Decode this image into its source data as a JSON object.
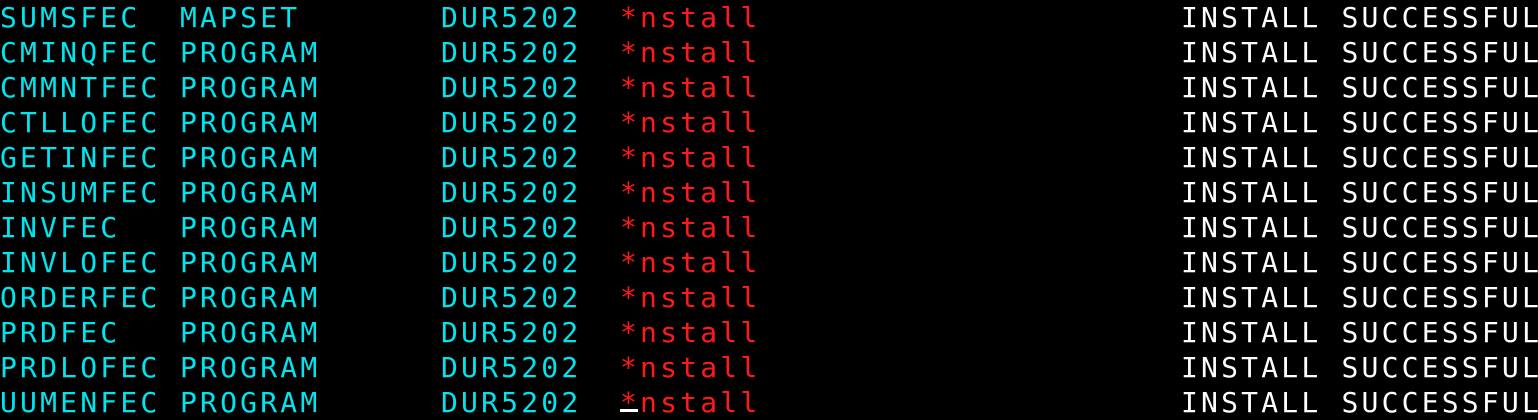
{
  "colors": {
    "background": "#000000",
    "field_text": "#00e5ee",
    "command_text": "#ff1a1a",
    "message_text": "#ffffff",
    "cursor": "#ffffff"
  },
  "rows": [
    {
      "name": "SUMSFEC",
      "type": "MAPSET",
      "group": "DUR5202",
      "command": "*nstall",
      "message": "INSTALL SUCCESSFUL"
    },
    {
      "name": "CMINQFEC",
      "type": "PROGRAM",
      "group": "DUR5202",
      "command": "*nstall",
      "message": "INSTALL SUCCESSFUL"
    },
    {
      "name": "CMMNTFEC",
      "type": "PROGRAM",
      "group": "DUR5202",
      "command": "*nstall",
      "message": "INSTALL SUCCESSFUL"
    },
    {
      "name": "CTLLOFEC",
      "type": "PROGRAM",
      "group": "DUR5202",
      "command": "*nstall",
      "message": "INSTALL SUCCESSFUL"
    },
    {
      "name": "GETINFEC",
      "type": "PROGRAM",
      "group": "DUR5202",
      "command": "*nstall",
      "message": "INSTALL SUCCESSFUL"
    },
    {
      "name": "INSUMFEC",
      "type": "PROGRAM",
      "group": "DUR5202",
      "command": "*nstall",
      "message": "INSTALL SUCCESSFUL"
    },
    {
      "name": "INVFEC",
      "type": "PROGRAM",
      "group": "DUR5202",
      "command": "*nstall",
      "message": "INSTALL SUCCESSFUL"
    },
    {
      "name": "INVLOFEC",
      "type": "PROGRAM",
      "group": "DUR5202",
      "command": "*nstall",
      "message": "INSTALL SUCCESSFUL"
    },
    {
      "name": "ORDERFEC",
      "type": "PROGRAM",
      "group": "DUR5202",
      "command": "*nstall",
      "message": "INSTALL SUCCESSFUL"
    },
    {
      "name": "PRDFEC",
      "type": "PROGRAM",
      "group": "DUR5202",
      "command": "*nstall",
      "message": "INSTALL SUCCESSFUL"
    },
    {
      "name": "PRDLOFEC",
      "type": "PROGRAM",
      "group": "DUR5202",
      "command": "*nstall",
      "message": "INSTALL SUCCESSFUL"
    },
    {
      "name": "UUMENFEC",
      "type": "PROGRAM",
      "group": "DUR5202",
      "command": "*nstall",
      "message": "INSTALL SUCCESSFUL"
    }
  ]
}
